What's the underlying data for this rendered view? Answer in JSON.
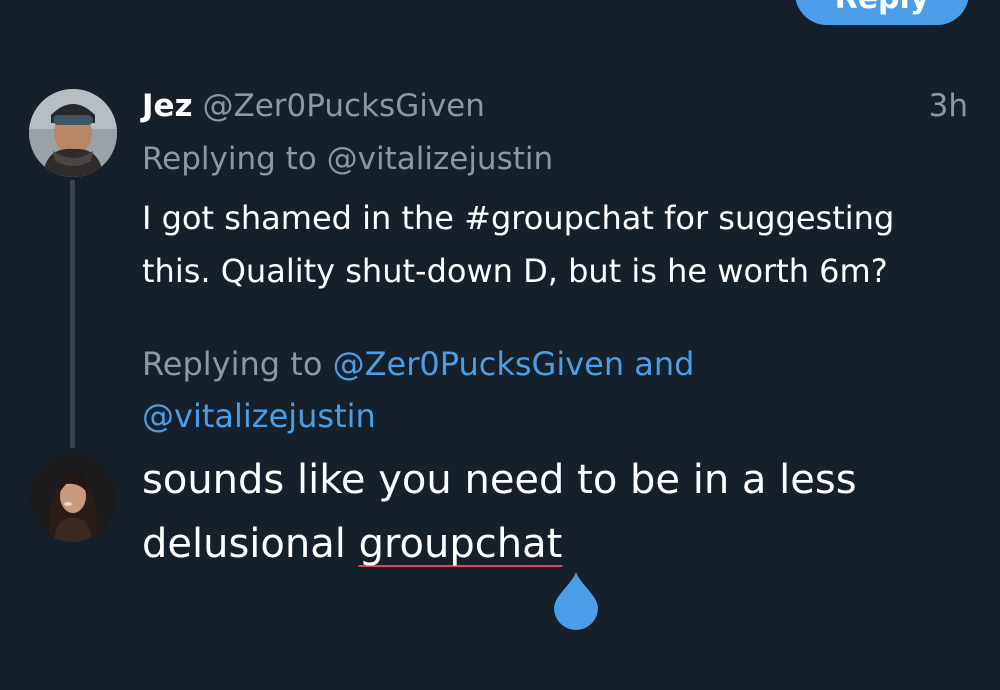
{
  "header": {
    "close_icon": "close-icon",
    "reply_button_label": "Reply"
  },
  "tweet": {
    "display_name": "Jez",
    "handle": "@Zer0PucksGiven",
    "time": "3h",
    "replying_prefix": "Replying to",
    "replying_to": "@vitalizejustin",
    "text": "I got shamed in the #groupchat for suggesting this. Quality shut-down D, but is he worth 6m?"
  },
  "reply": {
    "replying_prefix": "Replying to",
    "mention_1": "@Zer0PucksGiven",
    "and": "and",
    "mention_2": "@vitalizejustin",
    "draft_text_start": "sounds like you need to be in a less delusional",
    "draft_text_misspelled": "groupchat"
  },
  "colors": {
    "background": "#15202b",
    "accent": "#4a9ee8",
    "secondary_text": "#8b98a5",
    "thread_line": "#38444d",
    "spellcheck_underline": "#e0485a"
  }
}
